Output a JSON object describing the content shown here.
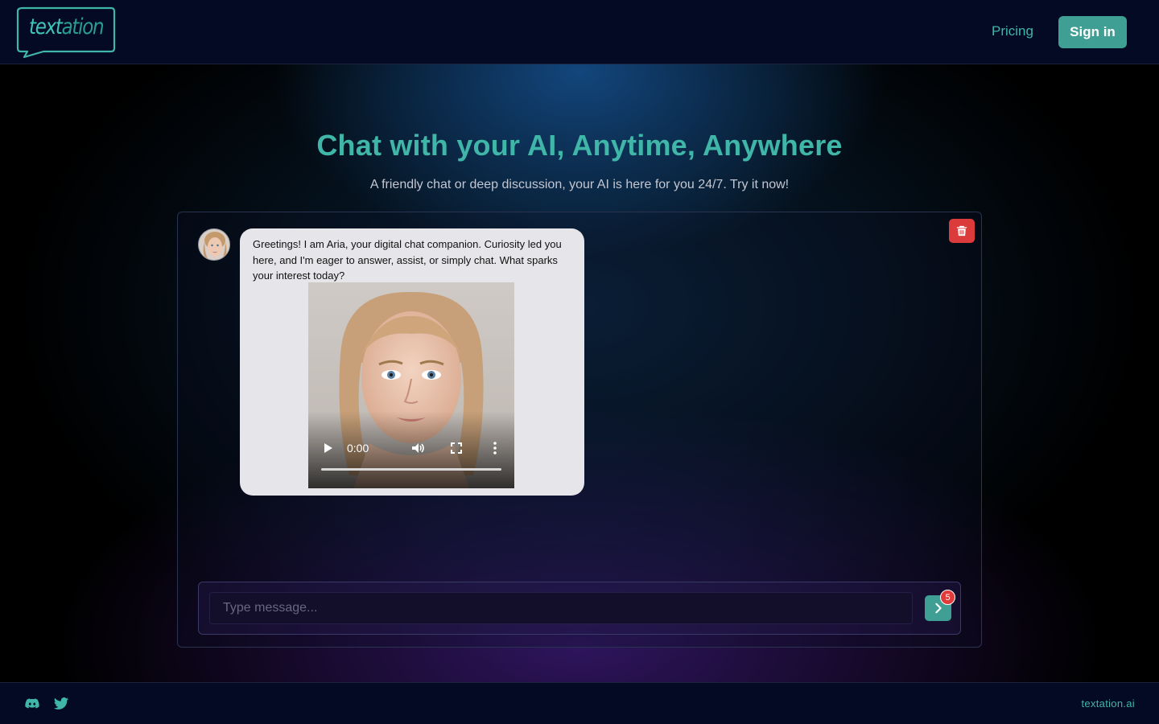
{
  "header": {
    "logo_text_bold": "text",
    "logo_text_thin": "ation",
    "nav_pricing": "Pricing",
    "signin_label": "Sign in"
  },
  "hero": {
    "title": "Chat with your AI, Anytime, Anywhere",
    "subtitle": "A friendly chat or deep discussion, your AI is here for you 24/7. Try it now!"
  },
  "chat": {
    "messages": [
      {
        "sender": "Aria",
        "text": "Greetings! I am Aria, your digital chat companion. Curiosity led you here, and I'm eager to answer, assist, or simply chat. What sparks your interest today?",
        "video": {
          "time": "0:00"
        }
      }
    ],
    "input": {
      "placeholder": "Type message...",
      "value": ""
    },
    "send_badge_count": "5"
  },
  "footer": {
    "domain": "textation.ai",
    "icons": [
      "discord-icon",
      "twitter-icon"
    ]
  },
  "colors": {
    "accent": "#3f9f95",
    "accent_text": "#3fb6a8",
    "danger": "#dc3b3b",
    "header_bg": "#050a24"
  }
}
